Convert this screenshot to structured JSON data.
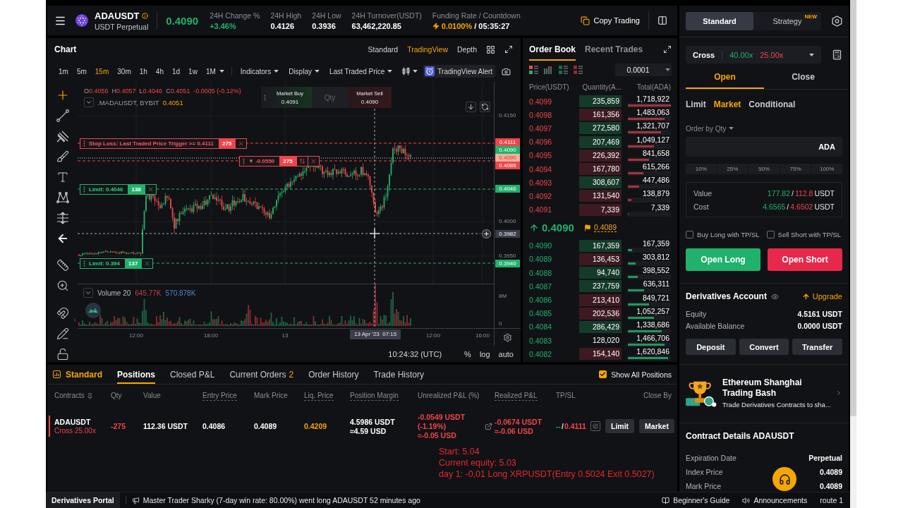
{
  "header": {
    "symbol": "ADAUSDT",
    "contract_type": "USDT Perpetual",
    "last_price": "0.4090",
    "stats": [
      {
        "label": "24H Change %",
        "value": "+3.46%",
        "kind": "up"
      },
      {
        "label": "24H High",
        "value": "0.4126",
        "kind": "plain"
      },
      {
        "label": "24H Low",
        "value": "0.3936",
        "kind": "plain"
      },
      {
        "label": "24H Turnover(USDT)",
        "value": "63,462,220.85",
        "kind": "plain"
      },
      {
        "label": "Funding Rate / Countdown",
        "value": "0.0100%",
        "countdown": "/ 05:35:27",
        "kind": "funding"
      }
    ],
    "copy_trading": "Copy Trading"
  },
  "chart": {
    "title": "Chart",
    "views": [
      {
        "label": "Standard",
        "selected": false
      },
      {
        "label": "TradingView",
        "selected": true
      },
      {
        "label": "Depth",
        "selected": false
      }
    ],
    "intervals": [
      {
        "label": "1m",
        "selected": false
      },
      {
        "label": "5m",
        "selected": false
      },
      {
        "label": "15m",
        "selected": true
      },
      {
        "label": "30m",
        "selected": false
      },
      {
        "label": "1h",
        "selected": false
      },
      {
        "label": "4h",
        "selected": false
      },
      {
        "label": "1d",
        "selected": false
      },
      {
        "label": "1w",
        "selected": false
      },
      {
        "label": "1M",
        "selected": false
      }
    ],
    "menus": [
      "Indicators",
      "Display",
      "Last Traded Price"
    ],
    "alert": "TradingView Alert",
    "legend": {
      "ohlc": [
        {
          "key": "O",
          "value": "0.4056"
        },
        {
          "key": "H",
          "value": "0.4057"
        },
        {
          "key": "L",
          "value": "0.4046"
        },
        {
          "key": "C",
          "value": "0.4051"
        }
      ],
      "change": "-0.0005 (-0.12%)",
      "series": ".MADAUSDT, BYBIT",
      "series_value": "0.4051"
    },
    "quick_trade": {
      "buy_label": "Market Buy",
      "buy_price": "0.4091",
      "qty_placeholder": "Qty",
      "sell_label": "Market Sell",
      "sell_price": "0.4090"
    },
    "order_tags": [
      {
        "kind": "stop",
        "text": "Stop Loss: Last Traded Price Trigger >= 0.4111",
        "qty": "275"
      },
      {
        "kind": "position",
        "text": "▼ -0.0550",
        "qty": "275"
      },
      {
        "kind": "limit",
        "text": "Limit: 0.4046",
        "qty": "138"
      },
      {
        "kind": "limit",
        "text": "Limit: 0.394",
        "qty": "137"
      }
    ],
    "price_ticks": [
      "0.4150",
      "0.4000",
      "0.3950"
    ],
    "price_tags": [
      {
        "kind": "stop",
        "value": "0.4111"
      },
      {
        "kind": "bid",
        "value": "0.4090"
      },
      {
        "kind": "last",
        "value": "0.4090"
      },
      {
        "kind": "entry",
        "value": "0.4086"
      },
      {
        "kind": "limit",
        "value": "0.4046"
      },
      {
        "kind": "crosshair",
        "value": "0.3982"
      },
      {
        "kind": "limit",
        "value": "0.3940"
      }
    ],
    "volume": {
      "label": "Volume 20",
      "value_1": "645.77K",
      "value_2": "570.878K",
      "ticks": [
        "8M",
        "0"
      ]
    },
    "time_ticks": [
      "12:00",
      "18:00",
      "13",
      "12:00",
      "16:00"
    ],
    "crosshair_time": "13 Apr '23  07:15",
    "footer": {
      "clock": "10:24:32 (UTC)",
      "scales": [
        "%",
        "log",
        "auto"
      ]
    }
  },
  "order_book": {
    "tabs": [
      {
        "label": "Order Book",
        "selected": true
      },
      {
        "label": "Recent Trades",
        "selected": false
      }
    ],
    "precision": "0.0001",
    "columns": [
      "Price(USDT)",
      "Quantity(A...",
      "Total(ADA)"
    ],
    "asks": [
      {
        "price": "0.4099",
        "qty": "235,859",
        "total": "1,718,922",
        "color": "#143a2a",
        "level": 1.0
      },
      {
        "price": "0.4098",
        "qty": "161,356",
        "total": "1,483,063",
        "color": "#3d1a21",
        "level": 0.86
      },
      {
        "price": "0.4097",
        "qty": "272,580",
        "total": "1,321,707",
        "color": "#143a2a",
        "level": 0.77
      },
      {
        "price": "0.4096",
        "qty": "207,469",
        "total": "1,049,127",
        "color": "#143a2a",
        "level": 0.61
      },
      {
        "price": "0.4095",
        "qty": "226,392",
        "total": "841,658",
        "color": "#3d1a21",
        "level": 0.49
      },
      {
        "price": "0.4094",
        "qty": "167,780",
        "total": "615,266",
        "color": "#3d1a21",
        "level": 0.36
      },
      {
        "price": "0.4093",
        "qty": "308,607",
        "total": "447,486",
        "color": "#143a2a",
        "level": 0.26
      },
      {
        "price": "0.4092",
        "qty": "131,540",
        "total": "138,879",
        "color": "#3d1a21",
        "level": 0.08
      },
      {
        "price": "0.4091",
        "qty": "7,339",
        "total": "7,339",
        "color": "#3d1a21",
        "level": 0.01
      }
    ],
    "last": {
      "price": "0.4090",
      "mark": "0.4089"
    },
    "bids": [
      {
        "price": "0.4090",
        "qty": "167,359",
        "total": "167,359",
        "color": "#143a2a",
        "level": 0.1
      },
      {
        "price": "0.4089",
        "qty": "136,453",
        "total": "303,812",
        "color": "#3d1a21",
        "level": 0.18
      },
      {
        "price": "0.4088",
        "qty": "94,740",
        "total": "398,552",
        "color": "#143a2a",
        "level": 0.23
      },
      {
        "price": "0.4087",
        "qty": "237,759",
        "total": "636,311",
        "color": "#143a2a",
        "level": 0.37
      },
      {
        "price": "0.4086",
        "qty": "213,410",
        "total": "849,721",
        "color": "#3d1a21",
        "level": 0.49
      },
      {
        "price": "0.4085",
        "qty": "202,536",
        "total": "1,052,257",
        "color": "#3d1a21",
        "level": 0.61
      },
      {
        "price": "0.4084",
        "qty": "286,429",
        "total": "1,338,686",
        "color": "#143a2a",
        "level": 0.78
      },
      {
        "price": "0.4083",
        "qty": "128,020",
        "total": "1,466,706",
        "level": 0.85
      },
      {
        "price": "0.4082",
        "qty": "154,140",
        "total": "1,620,846",
        "color": "#3d1a21",
        "level": 0.94
      }
    ]
  },
  "positions": {
    "mode": "Standard",
    "tabs": [
      {
        "label": "Positions",
        "selected": true
      },
      {
        "label": "Closed P&L",
        "selected": false
      },
      {
        "label": "Current Orders",
        "count": "2",
        "selected": false
      },
      {
        "label": "Order History",
        "selected": false
      },
      {
        "label": "Trade History",
        "selected": false
      }
    ],
    "show_all": {
      "label": "Show All Positions",
      "checked": true
    },
    "columns": [
      {
        "label": "Contracts",
        "underlined": false
      },
      {
        "label": "Qty",
        "underlined": false
      },
      {
        "label": "Value",
        "underlined": false
      },
      {
        "label": "Entry Price",
        "underlined": true
      },
      {
        "label": "Mark Price",
        "underlined": false
      },
      {
        "label": "Liq. Price",
        "underlined": true
      },
      {
        "label": "Position Margin",
        "underlined": true
      },
      {
        "label": "Unrealized P&L (%)",
        "underlined": false
      },
      {
        "label": "Realized P&L",
        "underlined": true
      },
      {
        "label": "TP/SL",
        "underlined": false
      },
      {
        "label": "Close By",
        "underlined": false
      }
    ],
    "rows": [
      {
        "contract": "ADAUSDT",
        "margin_mode": "Cross 25.00x",
        "short": true,
        "qty": "-275",
        "value": "112.36 USDT",
        "entry_price": "0.4086",
        "mark_price": "0.4089",
        "liq_price": "0.4209",
        "position_margin": [
          "4.5986 USDT",
          "≈4.59 USD"
        ],
        "loss": true,
        "unrealized": [
          "-0.0549 USDT",
          "(-1.19%)",
          "≈-0.05 USD"
        ],
        "realized": [
          "-0.0674 USDT",
          "≈-0.06 USD"
        ],
        "tpsl": [
          {
            "text": "--",
            "kind": "tp"
          },
          {
            "text": "/",
            "kind": "plain"
          },
          {
            "text": "0.4111",
            "kind": "sl"
          }
        ],
        "close_by": [
          "Limit",
          "Market"
        ]
      }
    ]
  },
  "trade": {
    "modes": [
      {
        "label": "Standard",
        "selected": true
      },
      {
        "label": "Strategy",
        "selected": false,
        "badge": "NEW"
      }
    ],
    "margin": {
      "mode": "Cross",
      "long": "40.00x",
      "short": "25.00x"
    },
    "sides": [
      {
        "label": "Open",
        "selected": true
      },
      {
        "label": "Close",
        "selected": false
      }
    ],
    "order_types": [
      {
        "label": "Limit",
        "selected": false
      },
      {
        "label": "Market",
        "selected": true
      },
      {
        "label": "Conditional",
        "selected": false
      }
    ],
    "qty_mode": "Order by Qty",
    "qty_unit": "ADA",
    "percents": [
      "10%",
      "25%",
      "50%",
      "75%",
      "100%"
    ],
    "summary": [
      {
        "label": "Value",
        "parts": [
          {
            "text": "177.82",
            "kind": "long"
          },
          {
            "text": "/",
            "kind": "plain"
          },
          {
            "text": "112.8",
            "kind": "short"
          },
          {
            "text": "USDT",
            "kind": "plain"
          }
        ]
      },
      {
        "label": "Cost",
        "parts": [
          {
            "text": "4.6565",
            "kind": "long"
          },
          {
            "text": "/",
            "kind": "plain"
          },
          {
            "text": "4.6502",
            "kind": "short"
          },
          {
            "text": "USDT",
            "kind": "plain"
          }
        ]
      }
    ],
    "tpsl": [
      {
        "label": "Buy Long with TP/SL",
        "checked": false
      },
      {
        "label": "Sell Short with TP/SL",
        "checked": false
      }
    ],
    "actions": [
      {
        "label": "Open Long",
        "kind": "long"
      },
      {
        "label": "Open Short",
        "kind": "short"
      }
    ]
  },
  "account": {
    "title": "Derivatives Account",
    "upgrade": "Upgrade",
    "rows": [
      {
        "label": "Equity",
        "value": "4.5161 USDT"
      },
      {
        "label": "Available Balance",
        "value": "0.0000 USDT"
      }
    ],
    "buttons": [
      "Deposit",
      "Convert",
      "Transfer"
    ]
  },
  "promo": {
    "title": "Ethereum Shanghai Trading Bash",
    "text": "Trade Derivatives Contracts to sha..."
  },
  "contract_details": {
    "title": "Contract Details ADAUSDT",
    "rows": [
      {
        "label": "Expiration Date",
        "value": "Perpetual"
      },
      {
        "label": "Index Price",
        "value": "0.4089"
      },
      {
        "label": "Mark Price",
        "value": "0.4089"
      }
    ]
  },
  "status_bar": {
    "portal": "Derivatives Portal",
    "ticker": "Master Trader Sharky (7-day win rate: 80.00%) went long ADAUSDT 52 minutes ago",
    "links": [
      {
        "label": "Beginner's Guide",
        "kind": "guide"
      },
      {
        "label": "Announcements",
        "kind": "news"
      },
      {
        "label": "route 1",
        "kind": "plain"
      }
    ]
  },
  "overlay_note": {
    "lines": [
      "Start: 5.04",
      "Current equity: 5.03",
      "day 1: -0,01 Long XRPUSDT(Entry 0.5024 Exit 0.5027)"
    ]
  }
}
